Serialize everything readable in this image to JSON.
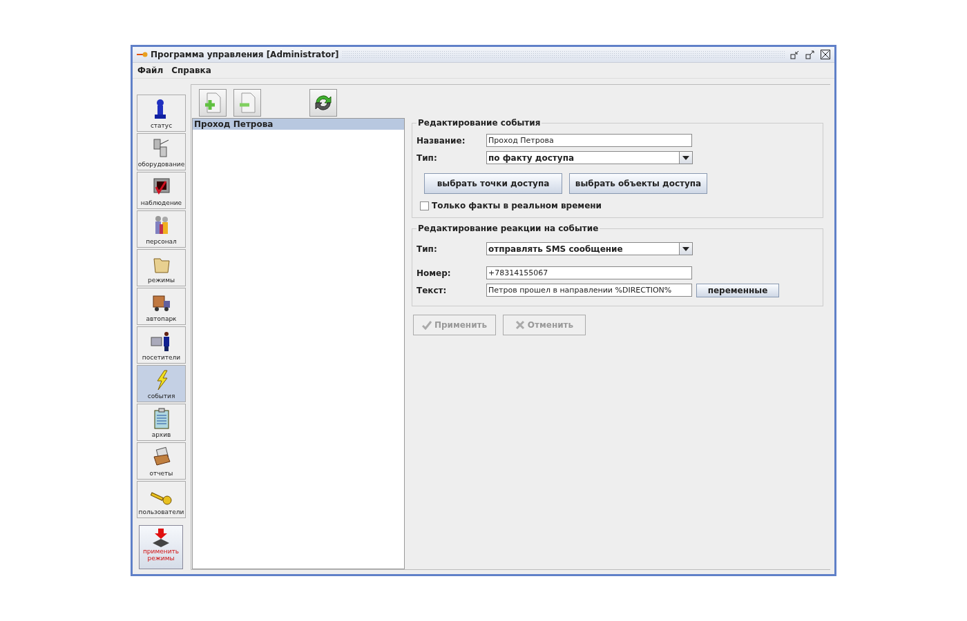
{
  "window": {
    "title": "Программа управления [Administrator]"
  },
  "menu": [
    "Файл",
    "Справка"
  ],
  "sidebar": {
    "items": [
      {
        "label": "статус",
        "selected": false
      },
      {
        "label": "оборудование",
        "selected": false
      },
      {
        "label": "наблюдение",
        "selected": false
      },
      {
        "label": "персонал",
        "selected": false
      },
      {
        "label": "режимы",
        "selected": false
      },
      {
        "label": "автопарк",
        "selected": false
      },
      {
        "label": "посетители",
        "selected": false
      },
      {
        "label": "события",
        "selected": true
      },
      {
        "label": "архив",
        "selected": false
      },
      {
        "label": "отчеты",
        "selected": false
      },
      {
        "label": "пользователи",
        "selected": false
      }
    ],
    "apply_button": "применить режимы"
  },
  "list": {
    "items": [
      {
        "label": "Проход Петрова",
        "selected": true
      }
    ]
  },
  "event_section": {
    "title": "Редактирование события",
    "name_label": "Название:",
    "name_value": "Проход Петрова",
    "type_label": "Тип:",
    "type_value": "по факту доступа",
    "buttons": [
      "выбрать точки доступа",
      "выбрать объекты доступа"
    ],
    "checkbox": {
      "label": "Только факты в реальном времени",
      "checked": false
    }
  },
  "reaction_section": {
    "title": "Редактирование реакции на событие",
    "type_label": "Тип:",
    "type_value": "отправлять SMS сообщение",
    "number_label": "Номер:",
    "number_value": "+78314155067",
    "text_label": "Текст:",
    "text_value": "Петров прошел в направлении %DIRECTION%",
    "variables_button": "переменные"
  },
  "actions": [
    {
      "label": "Применить",
      "disabled": true
    },
    {
      "label": "Отменить",
      "disabled": true
    }
  ]
}
